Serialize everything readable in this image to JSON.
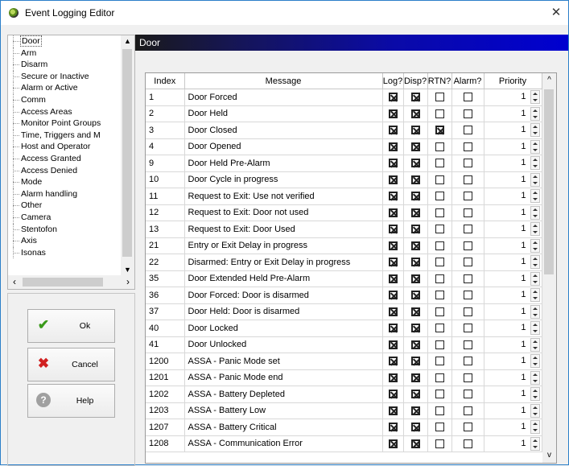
{
  "window": {
    "title": "Event Logging Editor",
    "close_glyph": "✕"
  },
  "tree": {
    "items": [
      {
        "label": "Door",
        "selected": true
      },
      {
        "label": "Arm"
      },
      {
        "label": "Disarm"
      },
      {
        "label": "Secure or Inactive"
      },
      {
        "label": "Alarm or Active"
      },
      {
        "label": "Comm"
      },
      {
        "label": "Access Areas"
      },
      {
        "label": "Monitor Point Groups"
      },
      {
        "label": "Time, Triggers and M"
      },
      {
        "label": "Host and Operator"
      },
      {
        "label": "Access Granted"
      },
      {
        "label": "Access Denied"
      },
      {
        "label": "Mode"
      },
      {
        "label": "Alarm handling"
      },
      {
        "label": "Other"
      },
      {
        "label": "Camera"
      },
      {
        "label": "Stentofon"
      },
      {
        "label": "Axis"
      },
      {
        "label": "Isonas"
      }
    ],
    "scroll_up": "▲",
    "scroll_down": "▼",
    "scroll_left": "‹",
    "scroll_right": "›"
  },
  "buttons": {
    "ok": {
      "label": "Ok",
      "icon": "check-icon",
      "glyph": "✔"
    },
    "cancel": {
      "label": "Cancel",
      "icon": "x-icon",
      "glyph": "✖"
    },
    "help": {
      "label": "Help",
      "icon": "help-icon",
      "glyph": "?"
    }
  },
  "pane": {
    "header": "Door"
  },
  "grid": {
    "columns": [
      "Index",
      "Message",
      "Log?",
      "Disp?",
      "RTN?",
      "Alarm?",
      "Priority"
    ],
    "rows": [
      {
        "index": "1",
        "message": "Door Forced",
        "log": true,
        "disp": true,
        "rtn": false,
        "alarm": false,
        "priority": "1"
      },
      {
        "index": "2",
        "message": "Door Held",
        "log": true,
        "disp": true,
        "rtn": false,
        "alarm": false,
        "priority": "1"
      },
      {
        "index": "3",
        "message": "Door Closed",
        "log": true,
        "disp": true,
        "rtn": true,
        "alarm": false,
        "priority": "1"
      },
      {
        "index": "4",
        "message": "Door Opened",
        "log": true,
        "disp": true,
        "rtn": false,
        "alarm": false,
        "priority": "1"
      },
      {
        "index": "9",
        "message": "Door Held Pre-Alarm",
        "log": true,
        "disp": true,
        "rtn": false,
        "alarm": false,
        "priority": "1"
      },
      {
        "index": "10",
        "message": "Door Cycle in progress",
        "log": true,
        "disp": true,
        "rtn": false,
        "alarm": false,
        "priority": "1"
      },
      {
        "index": "11",
        "message": "Request to Exit: Use not verified",
        "log": true,
        "disp": true,
        "rtn": false,
        "alarm": false,
        "priority": "1"
      },
      {
        "index": "12",
        "message": "Request to Exit: Door not used",
        "log": true,
        "disp": true,
        "rtn": false,
        "alarm": false,
        "priority": "1"
      },
      {
        "index": "13",
        "message": "Request to Exit: Door Used",
        "log": true,
        "disp": true,
        "rtn": false,
        "alarm": false,
        "priority": "1"
      },
      {
        "index": "21",
        "message": "Entry or Exit Delay in progress",
        "log": true,
        "disp": true,
        "rtn": false,
        "alarm": false,
        "priority": "1"
      },
      {
        "index": "22",
        "message": "Disarmed: Entry or Exit Delay in progress",
        "log": true,
        "disp": true,
        "rtn": false,
        "alarm": false,
        "priority": "1"
      },
      {
        "index": "35",
        "message": "Door Extended Held Pre-Alarm",
        "log": true,
        "disp": true,
        "rtn": false,
        "alarm": false,
        "priority": "1"
      },
      {
        "index": "36",
        "message": "Door Forced: Door is disarmed",
        "log": true,
        "disp": true,
        "rtn": false,
        "alarm": false,
        "priority": "1"
      },
      {
        "index": "37",
        "message": "Door Held: Door is disarmed",
        "log": true,
        "disp": true,
        "rtn": false,
        "alarm": false,
        "priority": "1"
      },
      {
        "index": "40",
        "message": "Door Locked",
        "log": true,
        "disp": true,
        "rtn": false,
        "alarm": false,
        "priority": "1"
      },
      {
        "index": "41",
        "message": "Door Unlocked",
        "log": true,
        "disp": true,
        "rtn": false,
        "alarm": false,
        "priority": "1"
      },
      {
        "index": "1200",
        "message": "ASSA - Panic Mode set",
        "log": true,
        "disp": true,
        "rtn": false,
        "alarm": false,
        "priority": "1"
      },
      {
        "index": "1201",
        "message": "ASSA - Panic Mode end",
        "log": true,
        "disp": true,
        "rtn": false,
        "alarm": false,
        "priority": "1"
      },
      {
        "index": "1202",
        "message": "ASSA - Battery Depleted",
        "log": true,
        "disp": true,
        "rtn": false,
        "alarm": false,
        "priority": "1"
      },
      {
        "index": "1203",
        "message": "ASSA - Battery Low",
        "log": true,
        "disp": true,
        "rtn": false,
        "alarm": false,
        "priority": "1"
      },
      {
        "index": "1207",
        "message": "ASSA - Battery Critical",
        "log": true,
        "disp": true,
        "rtn": false,
        "alarm": false,
        "priority": "1"
      },
      {
        "index": "1208",
        "message": "ASSA - Communication Error",
        "log": true,
        "disp": true,
        "rtn": false,
        "alarm": false,
        "priority": "1"
      }
    ],
    "scroll_up": "^",
    "scroll_down": "v"
  }
}
